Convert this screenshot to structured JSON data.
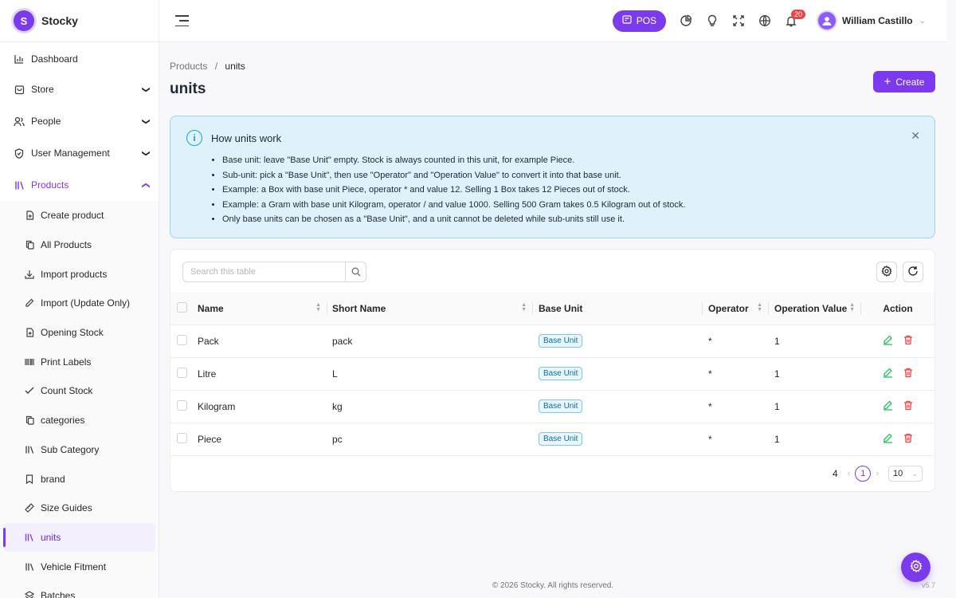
{
  "app": {
    "name": "Stocky",
    "logo_letter": "S"
  },
  "sidebar": {
    "items": [
      {
        "label": "Dashboard",
        "icon": "chart-bar-icon"
      },
      {
        "label": "Store",
        "icon": "store-icon",
        "chevron": "down"
      },
      {
        "label": "People",
        "icon": "people-icon",
        "chevron": "down"
      },
      {
        "label": "User Management",
        "icon": "shield-icon",
        "chevron": "down"
      },
      {
        "label": "Products",
        "icon": "products-icon",
        "chevron": "up",
        "active": true
      }
    ],
    "product_subitems": [
      {
        "label": "Create product",
        "icon": "file-plus-icon"
      },
      {
        "label": "All Products",
        "icon": "copy-icon"
      },
      {
        "label": "Import products",
        "icon": "download-icon"
      },
      {
        "label": "Import (Update Only)",
        "icon": "pencil-icon"
      },
      {
        "label": "Opening Stock",
        "icon": "file-plus-icon"
      },
      {
        "label": "Print Labels",
        "icon": "barcode-icon"
      },
      {
        "label": "Count Stock",
        "icon": "check-icon"
      },
      {
        "label": "categories",
        "icon": "copy-icon"
      },
      {
        "label": "Sub Category",
        "icon": "library-icon"
      },
      {
        "label": "brand",
        "icon": "bookmark-icon"
      },
      {
        "label": "Size Guides",
        "icon": "ruler-icon"
      },
      {
        "label": "units",
        "icon": "units-icon",
        "active": true
      },
      {
        "label": "Vehicle Fitment",
        "icon": "library-icon"
      },
      {
        "label": "Batches",
        "icon": "layers-icon"
      }
    ]
  },
  "header": {
    "pos_label": "POS",
    "notification_count": "20",
    "user_name": "William Castillo"
  },
  "breadcrumb": {
    "parent": "Products",
    "separator": "/",
    "current": "units"
  },
  "page_title": "units",
  "create_label": "Create",
  "info": {
    "title": "How units work",
    "lines": [
      "Base unit: leave \"Base Unit\" empty. Stock is always counted in this unit, for example Piece.",
      "Sub-unit: pick a \"Base Unit\", then use \"Operator\" and \"Operation Value\" to convert it into that base unit.",
      "Example: a Box with base unit Piece, operator * and value 12. Selling 1 Box takes 12 Pieces out of stock.",
      "Example: a Gram with base unit Kilogram, operator / and value 1000. Selling 500 Gram takes 0.5 Kilogram out of stock.",
      "Only base units can be chosen as a \"Base Unit\", and a unit cannot be deleted while sub-units still use it."
    ]
  },
  "table": {
    "search_placeholder": "Search this table",
    "columns": [
      "Name",
      "Short Name",
      "Base Unit",
      "Operator",
      "Operation Value",
      "Action"
    ],
    "rows": [
      {
        "name": "Pack",
        "short_name": "pack",
        "base_unit": "Base Unit",
        "operator": "*",
        "operation_value": "1"
      },
      {
        "name": "Litre",
        "short_name": "L",
        "base_unit": "Base Unit",
        "operator": "*",
        "operation_value": "1"
      },
      {
        "name": "Kilogram",
        "short_name": "kg",
        "base_unit": "Base Unit",
        "operator": "*",
        "operation_value": "1"
      },
      {
        "name": "Piece",
        "short_name": "pc",
        "base_unit": "Base Unit",
        "operator": "*",
        "operation_value": "1"
      }
    ],
    "total": "4",
    "current_page": "1",
    "page_size": "10"
  },
  "footer": {
    "copyright": "© 2026 Stocky. All rights reserved.",
    "version": "v5.7"
  },
  "colors": {
    "accent": "#7c3aed",
    "info_bg": "#dff1fb",
    "edit": "#22c55e",
    "delete": "#ef4444"
  }
}
